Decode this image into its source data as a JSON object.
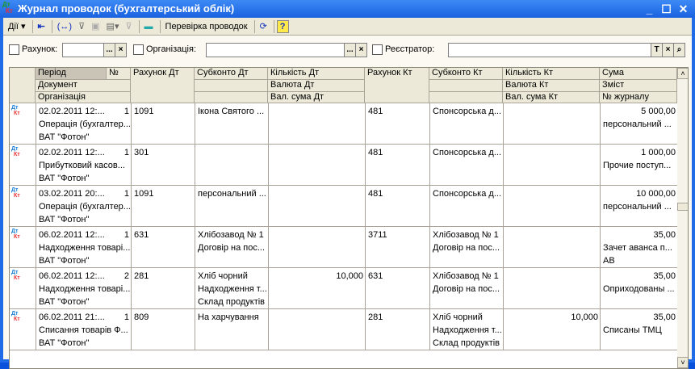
{
  "window": {
    "title": "Журнал проводок (бухгалтерський облік)",
    "minimize": "_",
    "maximize": "☐",
    "close": "✕",
    "icon_dt": "Дт",
    "icon_kt": "Кт"
  },
  "toolbar": {
    "actions": "Дії ▾",
    "check": "Перевірка проводок",
    "help": "?"
  },
  "filters": {
    "account_label": "Рахунок:",
    "org_label": "Організація:",
    "registrar_label": "Реєстратор:",
    "account_value": "",
    "org_value": "",
    "registrar_value": "",
    "dots": "...",
    "clear": "×",
    "type": "T",
    "search": "⌕"
  },
  "columns": {
    "period": "Період",
    "num": "№",
    "document": "Документ",
    "org": "Організація",
    "acc_dt": "Рахунок Дт",
    "sub_dt": "Субконто Дт",
    "qty_dt": "Кількість Дт",
    "cur_dt": "Валюта Дт",
    "cursum_dt": "Вал. сума Дт",
    "acc_kt": "Рахунок Кт",
    "sub_kt": "Субконто Кт",
    "qty_kt": "Кількість Кт",
    "cur_kt": "Валюта Кт",
    "cursum_kt": "Вал. сума Кт",
    "sum": "Сума",
    "content": "Зміст",
    "journal": "№ журналу"
  },
  "rows": [
    {
      "period": "02.02.2011 12:...",
      "num": "1",
      "doc": "Операція (бухгалтер...",
      "org": "ВАТ \"Фотон\"",
      "acc_dt": "1091",
      "sub_dt": [
        "Ікона Святого ...",
        "",
        ""
      ],
      "qty_dt": "",
      "acc_kt": "481",
      "sub_kt": [
        "Спонсорська д...",
        "",
        ""
      ],
      "qty_kt": "",
      "sum": "5 000,00",
      "content": "персональний ...",
      "journal": ""
    },
    {
      "period": "02.02.2011 12:...",
      "num": "1",
      "doc": "Прибутковий касов...",
      "org": "ВАТ \"Фотон\"",
      "acc_dt": "301",
      "sub_dt": [
        "",
        "",
        ""
      ],
      "qty_dt": "",
      "acc_kt": "481",
      "sub_kt": [
        "Спонсорська д...",
        "",
        ""
      ],
      "qty_kt": "",
      "sum": "1 000,00",
      "content": "Прочие поступ...",
      "journal": ""
    },
    {
      "period": "03.02.2011 20:...",
      "num": "1",
      "doc": "Операція (бухгалтер...",
      "org": "ВАТ \"Фотон\"",
      "acc_dt": "1091",
      "sub_dt": [
        "персональний ...",
        "",
        ""
      ],
      "qty_dt": "",
      "acc_kt": "481",
      "sub_kt": [
        "Спонсорська д...",
        "",
        ""
      ],
      "qty_kt": "",
      "sum": "10 000,00",
      "content": "персональний ...",
      "journal": ""
    },
    {
      "period": "06.02.2011 12:...",
      "num": "1",
      "doc": "Надходження товарі...",
      "org": "ВАТ \"Фотон\"",
      "acc_dt": "631",
      "sub_dt": [
        "Хлібозавод № 1",
        "Договір на пос...",
        ""
      ],
      "qty_dt": "",
      "acc_kt": "3711",
      "sub_kt": [
        "Хлібозавод № 1",
        "Договір на пос...",
        ""
      ],
      "qty_kt": "",
      "sum": "35,00",
      "content": "Зачет аванса п...",
      "journal": "АВ"
    },
    {
      "period": "06.02.2011 12:...",
      "num": "2",
      "doc": "Надходження товарі...",
      "org": "ВАТ \"Фотон\"",
      "acc_dt": "281",
      "sub_dt": [
        "Хліб чорний",
        "Надходження т...",
        "Склад продуктів"
      ],
      "qty_dt": "10,000",
      "acc_kt": "631",
      "sub_kt": [
        "Хлібозавод № 1",
        "Договір на пос...",
        ""
      ],
      "qty_kt": "",
      "sum": "35,00",
      "content": "Оприходованы ...",
      "journal": ""
    },
    {
      "period": "06.02.2011 21:...",
      "num": "1",
      "doc": "Списання товарів Ф...",
      "org": "ВАТ \"Фотон\"",
      "acc_dt": "809",
      "sub_dt": [
        "На харчування",
        "",
        ""
      ],
      "qty_dt": "",
      "acc_kt": "281",
      "sub_kt": [
        "Хліб чорний",
        "Надходження т...",
        "Склад продуктів"
      ],
      "qty_kt": "10,000",
      "sum": "35,00",
      "content": "Списаны ТМЦ",
      "journal": ""
    }
  ],
  "scroll": {
    "up": "˄",
    "down": "˅"
  },
  "colors": {
    "title": "#1f6be8",
    "dt": "#1a7fd6",
    "kt": "#e83030"
  }
}
